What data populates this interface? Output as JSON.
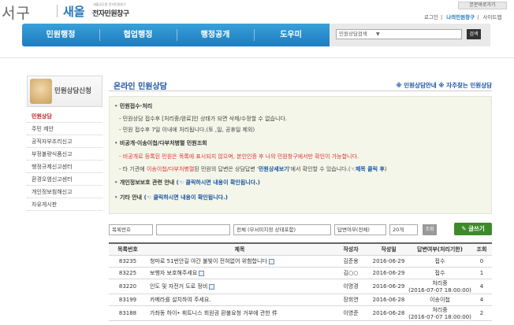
{
  "header": {
    "logo_gu": "서구",
    "logo_saeol": "새올",
    "logo_small": "새올공무원 전자민원창구",
    "logo_sub": "전자민원창구",
    "quick_button": "본문바로가기",
    "util_links": [
      "로그인",
      "나의민원창구",
      "사이트맵"
    ]
  },
  "nav": {
    "items": [
      "민원행정",
      "협업행정",
      "행정공개",
      "도우미"
    ],
    "search_select": "민원상담검색",
    "search_button": "검색"
  },
  "sidebar": {
    "title": "민원상담신청",
    "items": [
      "민원상담",
      "주민 제안",
      "공직자부조리신고",
      "부정불량식품신고",
      "행정규제신고센터",
      "환경오염신고센터",
      "개인정보침해신고",
      "자유게시판"
    ],
    "active_index": 0
  },
  "page": {
    "title": "온라인 민원상담",
    "links": [
      "※ 민원상담안내",
      "※ 자주찾는 민원상담"
    ]
  },
  "info": {
    "s1_head": "민원접수·처리",
    "s1_l1": "- 민원상담 접수후 [처리중/완료]인 상태가 되면 삭제/수정할 수 없습니다.",
    "s1_l2": "- 민원 접수후 7일 이내에 처리됩니다.(토 ,일, 공휴일 제외)",
    "s2_head": "비공개·이송이첩/다부처병렬 민원조회",
    "s2_l1_red": "- 비공개로 등록된 민원은 목록에 표시되지 않으며, 본인인증 후 나의 민원창구에서만 확인이 가능합니다.",
    "s2_l2_a": "- 타 기관에 ",
    "s2_l2_red": "이송이첩/다부처병렬",
    "s2_l2_b": "된 민원의 답변은 상담답변 '",
    "s2_l2_blue": "민원상세보기",
    "s2_l2_c": "'에서 확인할 수 있습니다.(☜",
    "s2_l2_blue2": "제목 클릭 후",
    "s2_l2_d": ")",
    "s3_head": "개인정보보호 관련 안내",
    "s3_link": "(☜ 클릭하시면 내용이 확인됩니다.)",
    "s4_head": "기타 안내",
    "s4_link": "(☜ 클릭하시면 내용이 확인됩니다.)"
  },
  "filter": {
    "field_select": "목록번호",
    "search_value": "",
    "status_select": "전체 (부서미지정 상태포함)",
    "answer_select": "답변여부(전체)",
    "count_select": "20개",
    "search_button": "조회",
    "write_button": "글쓰기"
  },
  "table": {
    "headers": [
      "목록번호",
      "제목",
      "작성자",
      "작성일",
      "답변여부(처리기한)",
      "조회"
    ],
    "rows": [
      {
        "no": "83235",
        "title": "청마로 51번안길 야간 불빛이 전혀없어 위험합니다",
        "author": "김준용",
        "date": "2016-06-29",
        "answer": "접수",
        "answer2": "",
        "views": "0"
      },
      {
        "no": "83225",
        "title": "보행자 보호해주세요",
        "author": "김○○",
        "date": "2016-06-29",
        "answer": "접수",
        "answer2": "",
        "views": "1"
      },
      {
        "no": "83220",
        "title": "인도 및 자전거 도로 정비",
        "author": "이명경",
        "date": "2016-06-29",
        "answer": "처리중",
        "answer2": "(2016-07-07 18:00:00)",
        "views": "4"
      },
      {
        "no": "83199",
        "title": "카메라를 설치하여 주세요.",
        "author": "장희연",
        "date": "2016-06-28",
        "answer": "이송이첩",
        "answer2": "",
        "views": "4"
      },
      {
        "no": "83188",
        "title": "가좌동 하이• 휘트니스 회원권 환불요청 거부에 관한 件",
        "author": "이영준",
        "date": "2016-06-28",
        "answer": "처리중",
        "answer2": "(2016-07-07 18:00:00)",
        "views": "2"
      }
    ]
  }
}
